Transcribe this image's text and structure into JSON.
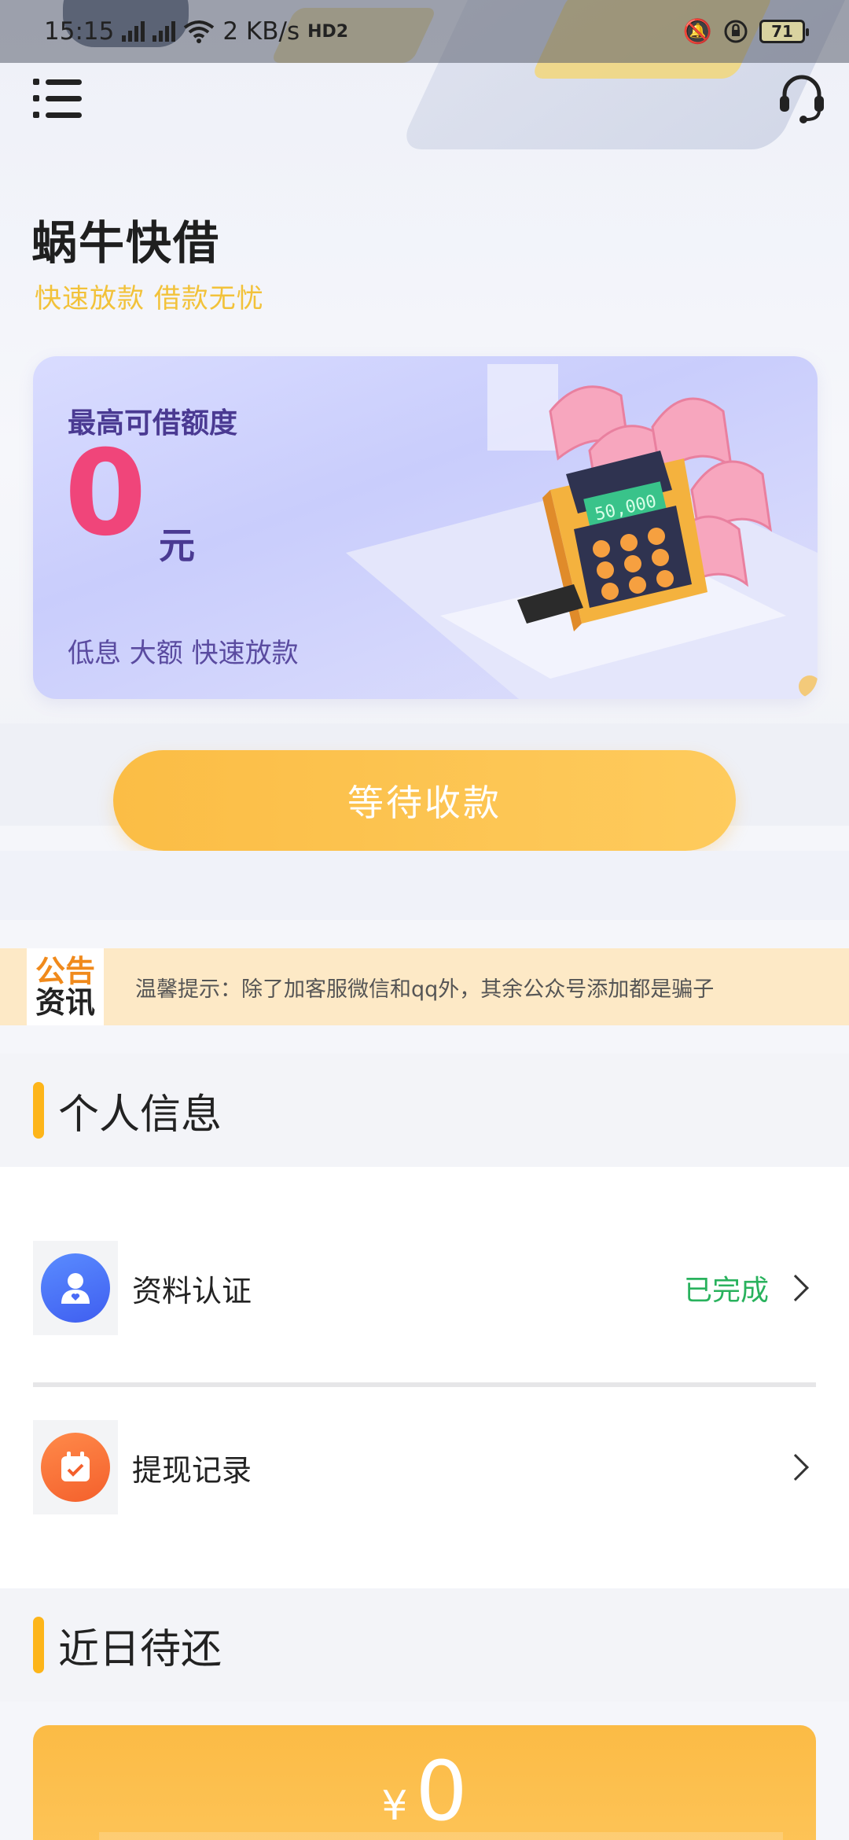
{
  "status_bar": {
    "time": "15:15",
    "speed": "2 KB/s",
    "hd_badge": "HD2",
    "battery": "71",
    "signal_label": "4G"
  },
  "header": {
    "menu_icon": "menu-icon",
    "support_icon": "headset-icon",
    "title": "蜗牛快借",
    "slogan": "快速放款 借款无忧"
  },
  "credit_card": {
    "label": "最高可借额度",
    "amount": "0",
    "unit": "元",
    "features": "低息 大额 快速放款",
    "screen_text": "50,000"
  },
  "cta": {
    "label": "等待收款"
  },
  "notice": {
    "badge_top": "公告",
    "badge_bottom": "资讯",
    "text": "温馨提示：除了加客服微信和qq外，其余公众号添加都是骗子"
  },
  "personal": {
    "title": "个人信息",
    "items": [
      {
        "label": "资料认证",
        "status": "已完成",
        "icon": "user-profile-icon"
      },
      {
        "label": "提现记录",
        "status": "",
        "icon": "calendar-check-icon"
      }
    ]
  },
  "repay": {
    "title": "近日待还",
    "currency": "¥",
    "amount": "0"
  },
  "colors": {
    "accent_yellow": "#fdb51a",
    "amount_pink": "#f0457a",
    "card_purple": "#4a3a92",
    "status_green": "#29b25d",
    "slogan_yellow": "#f2c23a"
  }
}
